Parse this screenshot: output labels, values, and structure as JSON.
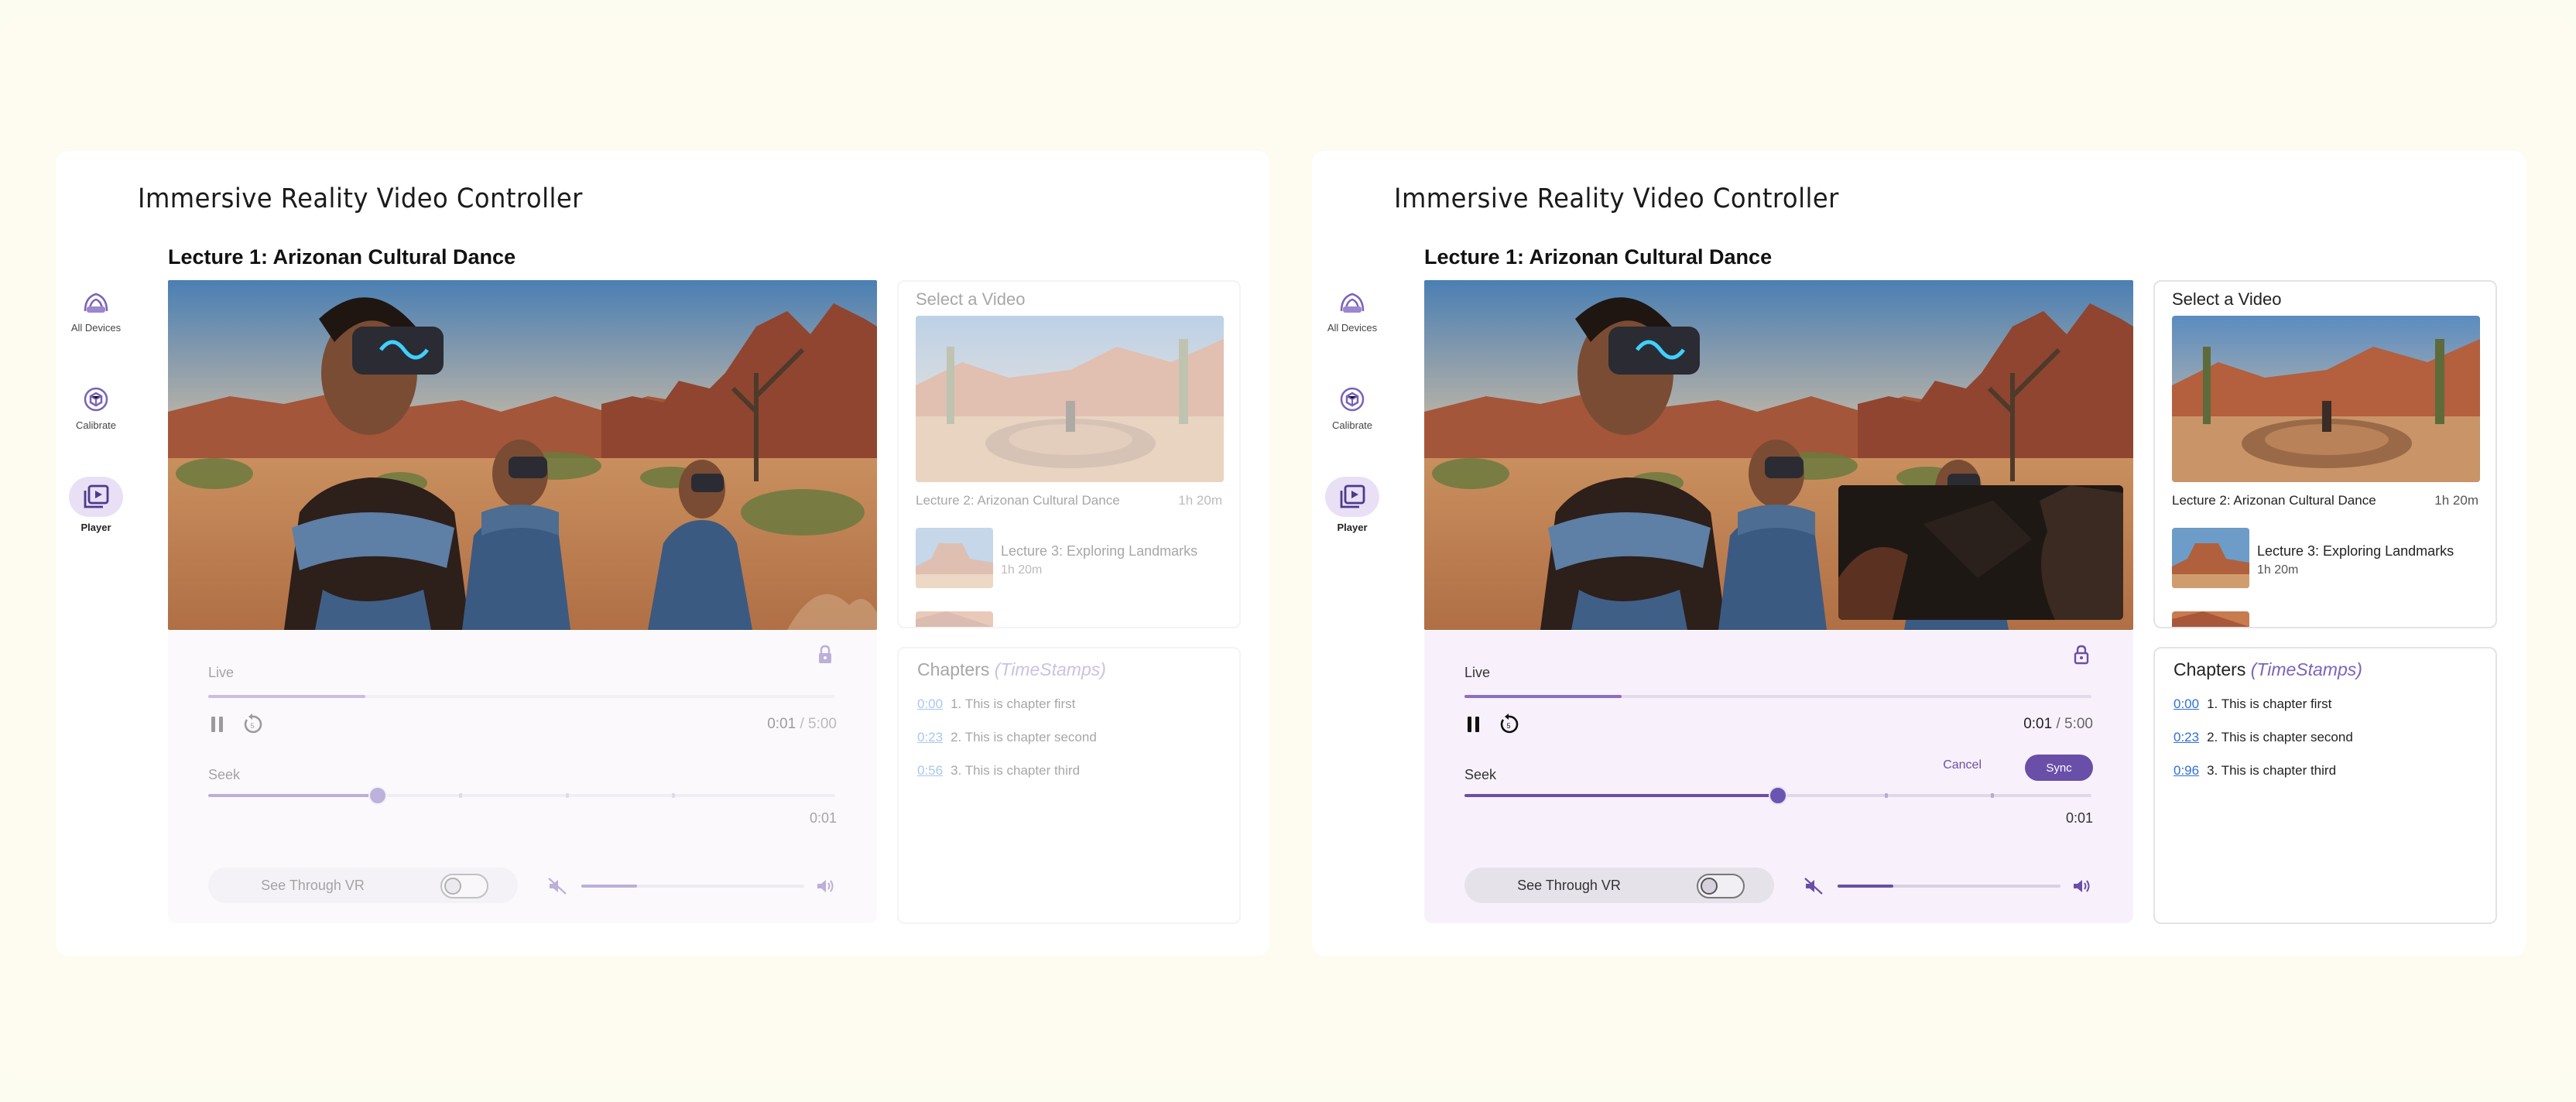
{
  "app_title": "Immersive Reality Video Controller",
  "colors": {
    "accent": "#6a4fa8",
    "accent_light": "#e9e0f6",
    "controls_bg": "#f8f1fb",
    "link": "#2f6fd6",
    "page_bg": "#fdfcf1"
  },
  "nav": [
    {
      "label": "All Devices",
      "icon": "devices-icon"
    },
    {
      "label": "Calibrate",
      "icon": "calibrate-icon"
    },
    {
      "label": "Player",
      "icon": "player-icon",
      "active": true
    }
  ],
  "left_panel": {
    "video_title": "Lecture 1: Arizonan Cultural Dance",
    "live_label": "Live",
    "live_progress": 0.25,
    "time_current": "0:01",
    "time_separator": " / ",
    "time_total": "5:00",
    "seek_label": "Seek",
    "seek_position": 0.27,
    "seek_time": "0:01",
    "see_through_label": "See Through VR",
    "volume_level": 0.25,
    "select_title": "Select a Video",
    "featured": {
      "name": "Lecture 2: Arizonan Cultural Dance",
      "duration": "1h 20m"
    },
    "videos": [
      {
        "name": "Lecture 3: Exploring Landmarks",
        "duration": "1h 20m"
      }
    ],
    "chapters_title": "Chapters",
    "chapters_subtitle": "(TimeStamps)",
    "chapters": [
      {
        "time": "0:00",
        "label": "1. This is chapter first"
      },
      {
        "time": "0:23",
        "label": "2. This is chapter second"
      },
      {
        "time": "0:56",
        "label": "3. This is chapter third"
      }
    ]
  },
  "right_panel": {
    "video_title": "Lecture 1: Arizonan Cultural Dance",
    "live_label": "Live",
    "live_progress": 0.25,
    "time_current": "0:01",
    "time_separator": " / ",
    "time_total": "5:00",
    "seek_label": "Seek",
    "seek_position": 0.5,
    "seek_time": "0:01",
    "cancel_label": "Cancel",
    "sync_label": "Sync",
    "see_through_label": "See Through VR",
    "volume_level": 0.25,
    "select_title": "Select a Video",
    "featured": {
      "name": "Lecture 2: Arizonan Cultural Dance",
      "duration": "1h 20m"
    },
    "videos": [
      {
        "name": "Lecture 3: Exploring Landmarks",
        "duration": "1h 20m"
      }
    ],
    "chapters_title": "Chapters",
    "chapters_subtitle": "(TimeStamps)",
    "chapters": [
      {
        "time": "0:00",
        "label": "1. This is chapter first"
      },
      {
        "time": "0:23",
        "label": "2. This is chapter second"
      },
      {
        "time": "0:96",
        "label": "3. This is chapter third"
      }
    ]
  }
}
